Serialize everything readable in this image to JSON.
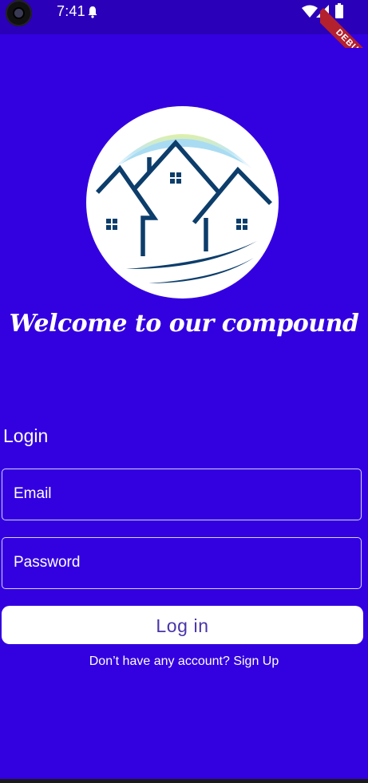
{
  "status_bar": {
    "time": "7:41",
    "debug_label": "DEBUG"
  },
  "welcome_text": "Welcome to our compound",
  "login": {
    "heading": "Login",
    "email_label": "Email",
    "password_label": "Password",
    "button_label": "Log in",
    "signup_text": "Don’t have any account? Sign Up"
  },
  "colors": {
    "background": "#3300e0",
    "status_bar": "#2a00b8",
    "button_bg": "#ffffff",
    "button_text": "#4a34a8",
    "logo_navy": "#0c3d6b"
  }
}
